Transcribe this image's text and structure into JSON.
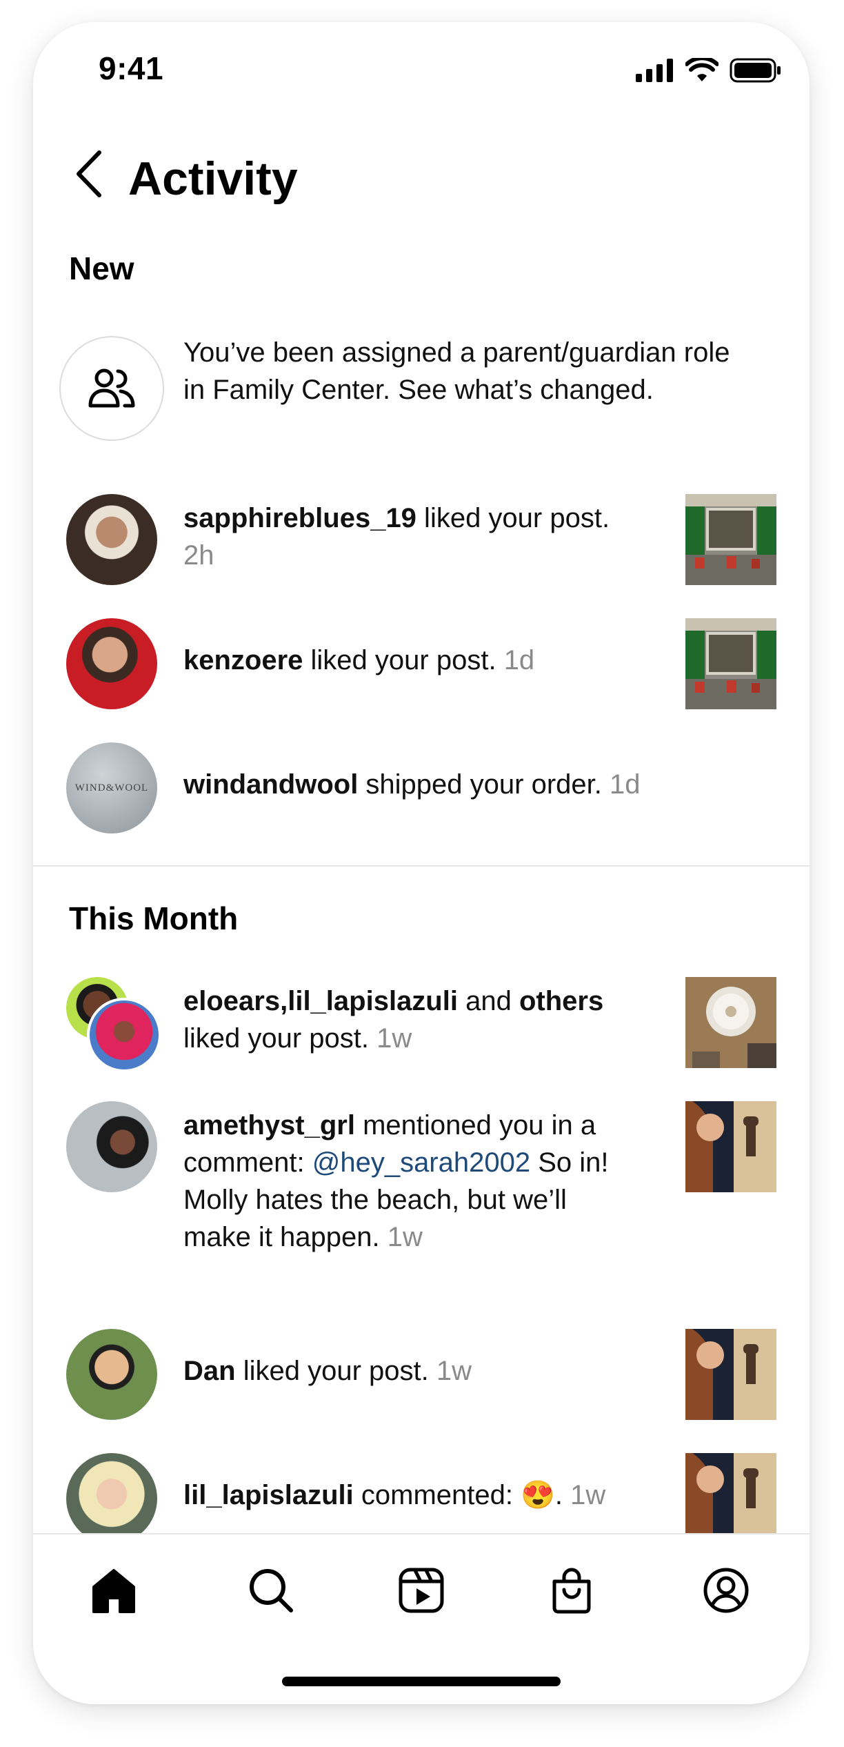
{
  "status_bar": {
    "time": "9:41"
  },
  "header": {
    "title": "Activity"
  },
  "sections": {
    "new": {
      "title": "New"
    },
    "this_month": {
      "title": "This Month"
    }
  },
  "notifications": {
    "family_center": {
      "text": "You’ve been assigned a parent/guardian role in Family Center. See what’s changed."
    },
    "sapphire": {
      "user": "sapphireblues_19",
      "action": " liked your post.",
      "time": "2h"
    },
    "kenzo": {
      "user": "kenzoere",
      "action": " liked your post.",
      "time": "1d"
    },
    "windandwool": {
      "user": "windandwool",
      "action": " shipped your order.",
      "time": "1d",
      "logo_text": "WIND&WOOL"
    },
    "eloears": {
      "user1": "eloears,lil_lapislazuli",
      "and": " and ",
      "user2": "others",
      "action": "liked your post.",
      "time": "1w"
    },
    "amethyst": {
      "user": "amethyst_grl",
      "action": " mentioned you in a comment: ",
      "mention": "@hey_sarah2002",
      "comment": " So in! Molly hates the beach, but we’ll make it happen.",
      "time": "1w"
    },
    "dan": {
      "user": "Dan",
      "action": " liked your post.",
      "time": "1w"
    },
    "lil": {
      "user": "lil_lapislazuli",
      "action": " commented: ",
      "emoji": "😍",
      "dot": ".",
      "time": "1w"
    }
  },
  "tab_bar": {
    "items": [
      "home-icon",
      "search-icon",
      "reels-icon",
      "shop-icon",
      "profile-icon"
    ]
  }
}
